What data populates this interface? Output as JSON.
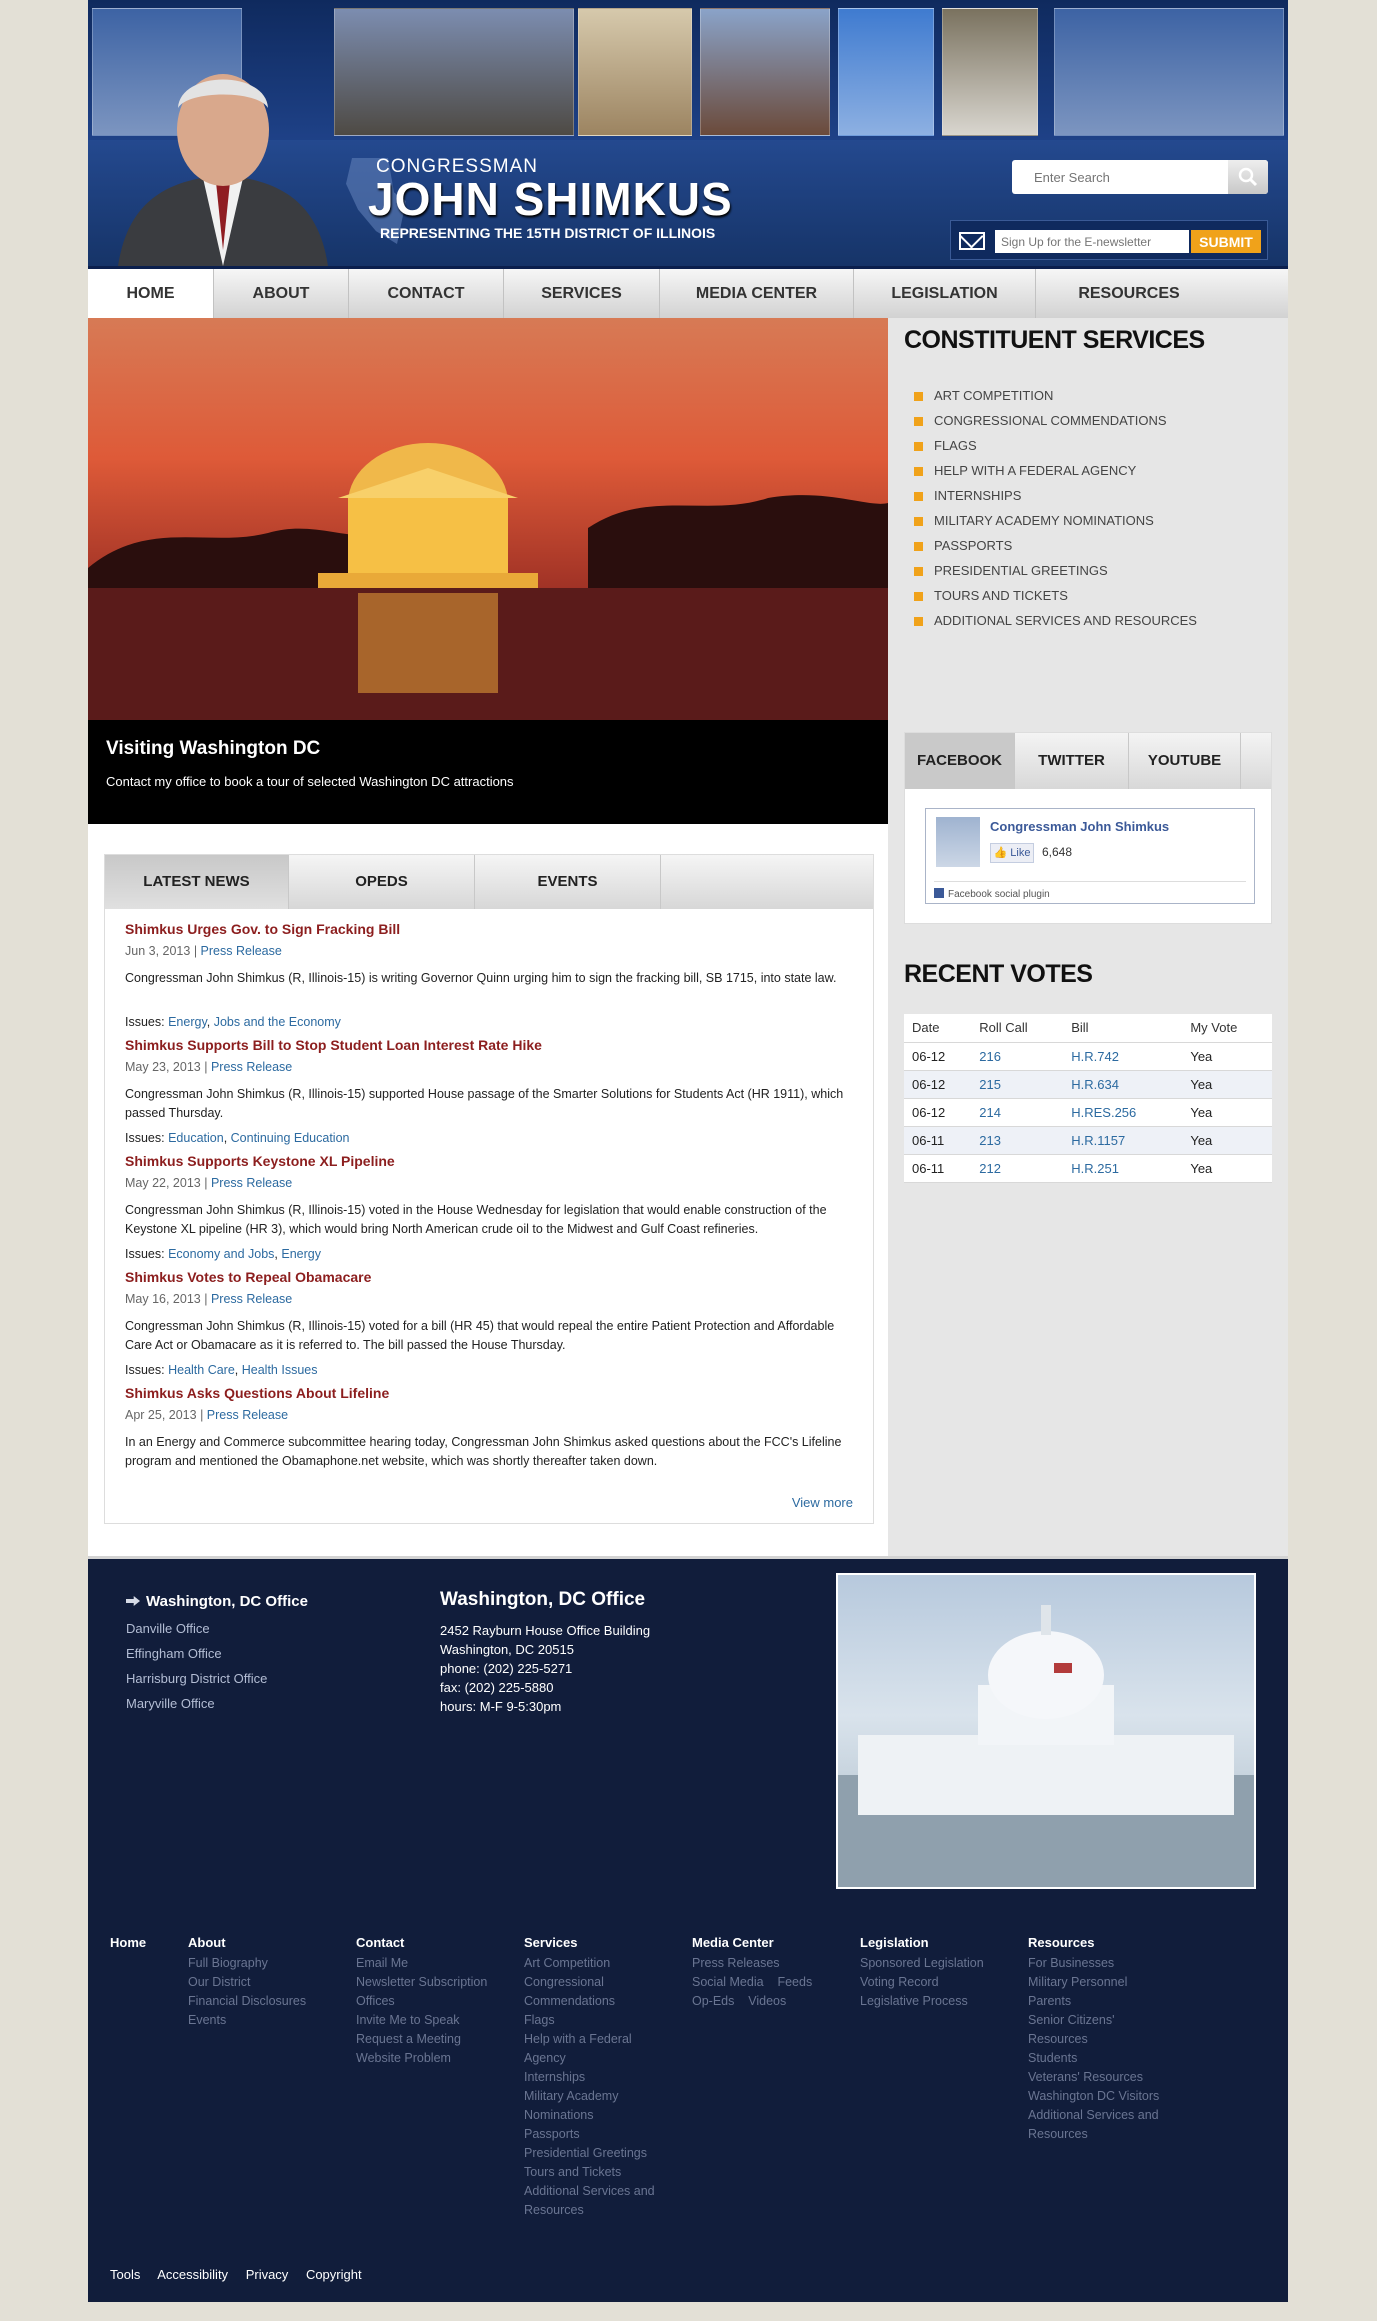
{
  "header": {
    "congressman_label": "CONGRESSMAN",
    "name": "JOHN SHIMKUS",
    "tagline": "REPRESENTING THE 15TH DISTRICT OF ILLINOIS",
    "search_placeholder": "Enter Search",
    "newsletter_placeholder": "Sign Up for the E-newsletter",
    "newsletter_submit": "SUBMIT",
    "photo_strip": [
      {
        "name": "capitol-dome",
        "color": "#4a6ea8"
      },
      {
        "name": "county-courthouse",
        "color": "#5c5a55"
      },
      {
        "name": "statue-poster",
        "color": "#c9b99a"
      },
      {
        "name": "superman-statue",
        "color": "#6b4a3a"
      },
      {
        "name": "catsup-bottle-tower",
        "color": "#5a86c4"
      },
      {
        "name": "white-squirrel",
        "color": "#6e6a5e"
      },
      {
        "name": "capitol-dome-right",
        "color": "#4a6ea8"
      }
    ]
  },
  "nav": [
    "HOME",
    "ABOUT",
    "CONTACT",
    "SERVICES",
    "MEDIA CENTER",
    "LEGISLATION",
    "RESOURCES"
  ],
  "hero": {
    "title": "Visiting Washington DC",
    "subtitle": "Contact my office to book a tour of selected Washington DC attractions"
  },
  "news": {
    "tabs": [
      "LATEST NEWS",
      "OPEDS",
      "EVENTS"
    ],
    "items": [
      {
        "title": "Shimkus Urges Gov. to Sign Fracking Bill",
        "date": "Jun 3, 2013",
        "type": "Press Release",
        "text": "Congressman John Shimkus (R, Illinois-15) is writing Governor Quinn urging him to sign the fracking bill, SB 1715, into state law.",
        "issues_label": "Issues:",
        "issues": [
          "Energy",
          "Jobs and the Economy"
        ]
      },
      {
        "title": "Shimkus Supports Bill to Stop Student Loan Interest Rate Hike",
        "date": "May 23, 2013",
        "type": "Press Release",
        "text": "Congressman John Shimkus (R, Illinois-15) supported House passage of the Smarter Solutions for Students Act (HR 1911), which passed Thursday.",
        "issues_label": "Issues:",
        "issues": [
          "Education",
          "Continuing Education"
        ]
      },
      {
        "title": "Shimkus Supports Keystone XL Pipeline",
        "date": "May 22, 2013",
        "type": "Press Release",
        "text": "Congressman John Shimkus (R, Illinois-15) voted in the House Wednesday for legislation that would enable construction of the Keystone XL pipeline (HR 3), which would bring North American crude oil to the Midwest and Gulf Coast refineries.",
        "issues_label": "Issues:",
        "issues": [
          "Economy and Jobs",
          "Energy"
        ]
      },
      {
        "title": "Shimkus Votes to Repeal Obamacare",
        "date": "May 16, 2013",
        "type": "Press Release",
        "text": "Congressman John Shimkus (R, Illinois-15) voted for a bill (HR 45) that would repeal the entire Patient Protection and Affordable Care Act or Obamacare as it is referred to. The bill passed the House Thursday.",
        "issues_label": "Issues:",
        "issues": [
          "Health Care",
          "Health Issues"
        ]
      },
      {
        "title": "Shimkus Asks Questions About Lifeline",
        "date": "Apr 25, 2013",
        "type": "Press Release",
        "text": "In an Energy and Commerce subcommittee hearing today, Congressman John Shimkus asked questions about the FCC's Lifeline program and mentioned the Obamaphone.net website, which was shortly thereafter taken down.",
        "issues_label": "",
        "issues": []
      }
    ],
    "view_more": "View more"
  },
  "constituent": {
    "title": "CONSTITUENT SERVICES",
    "items": [
      "ART COMPETITION",
      "CONGRESSIONAL COMMENDATIONS",
      "FLAGS",
      "HELP WITH A FEDERAL AGENCY",
      "INTERNSHIPS",
      "MILITARY ACADEMY NOMINATIONS",
      "PASSPORTS",
      "PRESIDENTIAL GREETINGS",
      "TOURS AND TICKETS",
      "ADDITIONAL SERVICES AND RESOURCES"
    ]
  },
  "social": {
    "tabs": [
      "FACEBOOK",
      "TWITTER",
      "YOUTUBE"
    ],
    "fb_name": "Congressman John Shimkus",
    "fb_like": "Like",
    "fb_count": "6,648",
    "fb_plugin": "Facebook social plugin"
  },
  "votes": {
    "title": "RECENT VOTES",
    "headers": [
      "Date",
      "Roll Call",
      "Bill",
      "My Vote"
    ],
    "rows": [
      [
        "06-12",
        "216",
        "H.R.742",
        "Yea"
      ],
      [
        "06-12",
        "215",
        "H.R.634",
        "Yea"
      ],
      [
        "06-12",
        "214",
        "H.RES.256",
        "Yea"
      ],
      [
        "06-11",
        "213",
        "H.R.1157",
        "Yea"
      ],
      [
        "06-11",
        "212",
        "H.R.251",
        "Yea"
      ]
    ]
  },
  "footer": {
    "current_office": "Washington, DC Office",
    "offices": [
      "Danville Office",
      "Effingham Office",
      "Harrisburg District Office",
      "Maryville Office"
    ],
    "address_title": "Washington, DC Office",
    "address_lines": [
      "2452 Rayburn House Office Building",
      "Washington, DC 20515",
      "phone: (202) 225-5271",
      "fax: (202) 225-5880",
      "hours: M-F 9-5:30pm"
    ],
    "sitemap": [
      {
        "head": "Home",
        "links": []
      },
      {
        "head": "About",
        "links": [
          "Full Biography",
          "Our District",
          "Financial Disclosures",
          "Events"
        ]
      },
      {
        "head": "Contact",
        "links": [
          "Email Me",
          "Newsletter Subscription",
          "Offices",
          "Invite Me to Speak",
          "Request a Meeting",
          "Website Problem"
        ]
      },
      {
        "head": "Services",
        "links": [
          "Art Competition",
          "Congressional",
          "Commendations",
          "Flags",
          "Help with a Federal",
          "Agency",
          "Internships",
          "Military Academy",
          "Nominations",
          "Passports",
          "Presidential Greetings",
          "Tours and Tickets",
          "Additional Services and",
          "Resources"
        ]
      },
      {
        "head": "Media Center",
        "links": [
          "Press Releases",
          "Social Media    Feeds",
          "Op-Eds    Videos"
        ]
      },
      {
        "head": "Legislation",
        "links": [
          "Sponsored Legislation",
          "Voting Record",
          "Legislative Process"
        ]
      },
      {
        "head": "Resources",
        "links": [
          "For Businesses",
          "Military Personnel",
          "Parents",
          "Senior Citizens'",
          "Resources",
          "Students",
          "Veterans' Resources",
          "Washington DC Visitors",
          "Additional Services and",
          "Resources"
        ]
      }
    ],
    "bottom_links": [
      "Tools",
      "Accessibility",
      "Privacy",
      "Copyright"
    ]
  }
}
